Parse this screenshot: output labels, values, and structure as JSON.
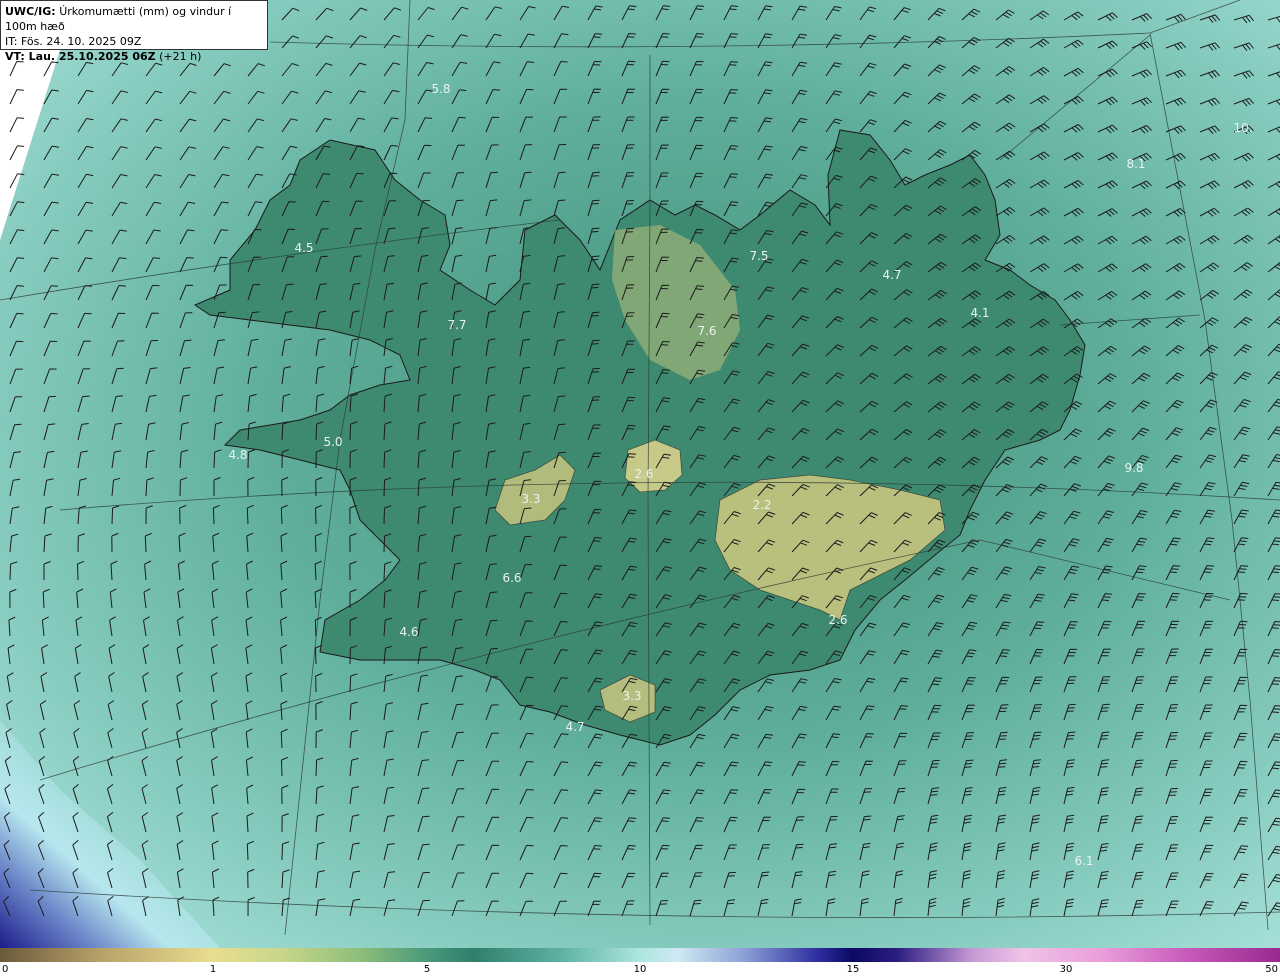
{
  "header": {
    "title_bold": "UWC/IG:",
    "title_rest": "Úrkomumætti (mm) og vindur í 100m hæð",
    "issue_time": "IT: Fös. 24. 10. 2025 09Z",
    "valid_label": "VT: Lau. 25.10.2025 06Z",
    "valid_offset": "(+21 h)"
  },
  "colorbar": {
    "ticks": [
      "0",
      "1",
      "5",
      "10",
      "15",
      "30",
      "50"
    ],
    "colors": [
      "#6b5a3a",
      "#e8de8e",
      "#2f7f6c",
      "#cfe9f3",
      "#0c0a62",
      "#ea9edb",
      "#9a2a8e"
    ]
  },
  "map_labels": [
    {
      "text": "5.8"
    },
    {
      "text": "4.5"
    },
    {
      "text": "7.5"
    },
    {
      "text": "4.7"
    },
    {
      "text": "4.1"
    },
    {
      "text": "7.7"
    },
    {
      "text": "7.6"
    },
    {
      "text": "5.0"
    },
    {
      "text": "4.8"
    },
    {
      "text": "2.6"
    },
    {
      "text": "3.3"
    },
    {
      "text": "2.2"
    },
    {
      "text": "6.6"
    },
    {
      "text": "4.6"
    },
    {
      "text": "2.6"
    },
    {
      "text": "3.3"
    },
    {
      "text": "4.7"
    },
    {
      "text": "10."
    },
    {
      "text": "8.1"
    },
    {
      "text": "9.8"
    },
    {
      "text": "6.1"
    }
  ]
}
